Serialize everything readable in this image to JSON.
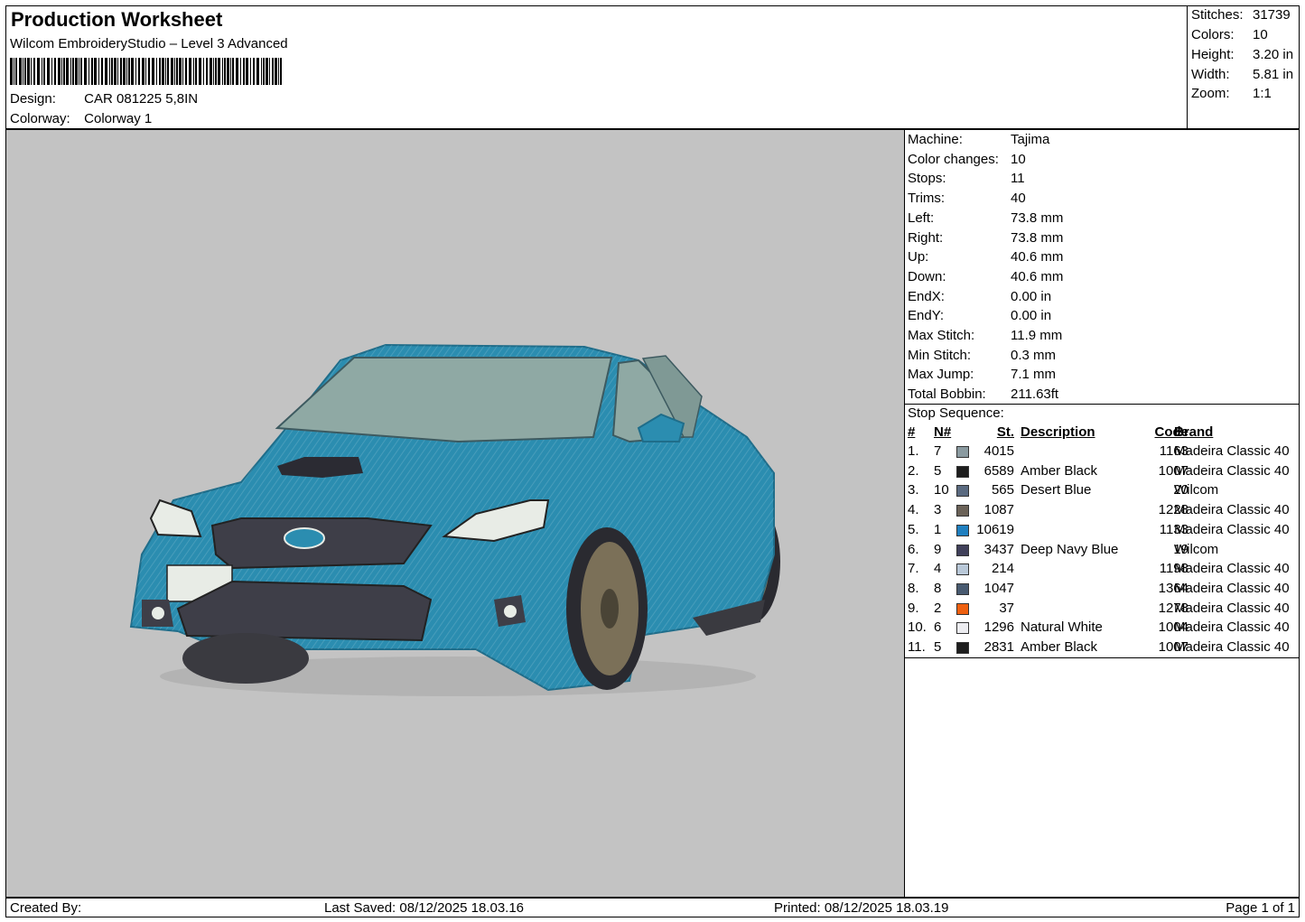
{
  "header": {
    "title": "Production Worksheet",
    "software": "Wilcom EmbroideryStudio – Level 3 Advanced",
    "design_label": "Design:",
    "design_value": "CAR 081225 5,8IN",
    "colorway_label": "Colorway:",
    "colorway_value": "Colorway 1"
  },
  "summary": {
    "stitches_label": "Stitches:",
    "stitches": "31739",
    "colors_label": "Colors:",
    "colors": "10",
    "height_label": "Height:",
    "height": "3.20 in",
    "width_label": "Width:",
    "width": "5.81 in",
    "zoom_label": "Zoom:",
    "zoom": "1:1"
  },
  "machine_info": [
    {
      "label": "Machine:",
      "value": "Tajima"
    },
    {
      "label": "Color changes:",
      "value": "10"
    },
    {
      "label": "Stops:",
      "value": "11"
    },
    {
      "label": "Trims:",
      "value": "40"
    },
    {
      "label": "Left:",
      "value": "73.8 mm"
    },
    {
      "label": "Right:",
      "value": "73.8 mm"
    },
    {
      "label": "Up:",
      "value": "40.6 mm"
    },
    {
      "label": "Down:",
      "value": "40.6 mm"
    },
    {
      "label": "EndX:",
      "value": "0.00 in"
    },
    {
      "label": "EndY:",
      "value": "0.00 in"
    },
    {
      "label": "Max Stitch:",
      "value": "11.9 mm"
    },
    {
      "label": "Min Stitch:",
      "value": "0.3 mm"
    },
    {
      "label": "Max Jump:",
      "value": "7.1 mm"
    },
    {
      "label": "Total Bobbin:",
      "value": "211.63ft"
    }
  ],
  "stop_sequence": {
    "title": "Stop Sequence:",
    "headers": {
      "idx": "#",
      "n": "N#",
      "st": "St.",
      "desc": "Description",
      "code": "Code",
      "brand": "Brand"
    },
    "rows": [
      {
        "idx": "1.",
        "n": "7",
        "color": "#8a9aa0",
        "st": "4015",
        "desc": "",
        "code": "1163",
        "brand": "Madeira Classic 40"
      },
      {
        "idx": "2.",
        "n": "5",
        "color": "#1e1e1e",
        "st": "6589",
        "desc": "Amber Black",
        "code": "1007",
        "brand": "Madeira Classic 40"
      },
      {
        "idx": "3.",
        "n": "10",
        "color": "#5a6a80",
        "st": "565",
        "desc": "Desert Blue",
        "code": "20",
        "brand": "Wilcom"
      },
      {
        "idx": "4.",
        "n": "3",
        "color": "#6b6258",
        "st": "1087",
        "desc": "",
        "code": "1228",
        "brand": "Madeira Classic 40"
      },
      {
        "idx": "5.",
        "n": "1",
        "color": "#1f7fbf",
        "st": "10619",
        "desc": "",
        "code": "1133",
        "brand": "Madeira Classic 40"
      },
      {
        "idx": "6.",
        "n": "9",
        "color": "#40405a",
        "st": "3437",
        "desc": "Deep Navy Blue",
        "code": "19",
        "brand": "Wilcom"
      },
      {
        "idx": "7.",
        "n": "4",
        "color": "#b9c8d8",
        "st": "214",
        "desc": "",
        "code": "1198",
        "brand": "Madeira Classic 40"
      },
      {
        "idx": "8.",
        "n": "8",
        "color": "#485a70",
        "st": "1047",
        "desc": "",
        "code": "1364",
        "brand": "Madeira Classic 40"
      },
      {
        "idx": "9.",
        "n": "2",
        "color": "#ee6010",
        "st": "37",
        "desc": "",
        "code": "1278",
        "brand": "Madeira Classic 40"
      },
      {
        "idx": "10.",
        "n": "6",
        "color": "#ececf0",
        "st": "1296",
        "desc": "Natural White",
        "code": "1004",
        "brand": "Madeira Classic 40"
      },
      {
        "idx": "11.",
        "n": "5",
        "color": "#1e1e1e",
        "st": "2831",
        "desc": "Amber Black",
        "code": "1007",
        "brand": "Madeira Classic 40"
      }
    ]
  },
  "footer": {
    "created_by": "Created By:",
    "last_saved": "Last Saved: 08/12/2025 18.03.16",
    "printed": "Printed: 08/12/2025 18.03.19",
    "page": "Page 1 of 1"
  },
  "design_preview": {
    "subject": "car-embroidery",
    "colors": {
      "body": "#2b8db0",
      "glass": "#8fa9a4",
      "grille": "#3e3e48",
      "wheel": "#7b7058",
      "plate": "#e8ece6",
      "canvas": "#c3c3c3"
    }
  }
}
